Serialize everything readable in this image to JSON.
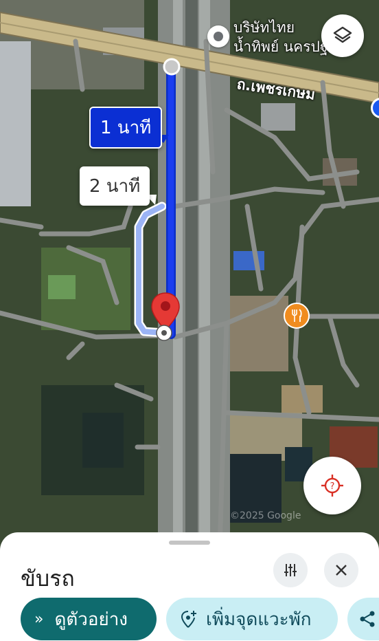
{
  "map": {
    "poi_label_line1": "บริษัทไทย",
    "poi_label_line2": "น้ำทิพย์ นครปฐม",
    "road_label": "ถ.เพชรเกษม",
    "route_selected_time": "1 นาที",
    "route_alt_time": "2 นาที",
    "watermark": "©2025 Google",
    "icons": {
      "layers": "layers-icon",
      "locate": "my-location-icon",
      "restaurant": "restaurant-icon",
      "destination": "red-pin-icon",
      "poi": "poi-marker-icon"
    },
    "colors": {
      "route_selected": "#1a3df0",
      "route_alt": "#9bb4f5",
      "pin": "#e53935",
      "restaurant": "#f08c1f"
    }
  },
  "sheet": {
    "title": "ขับรถ",
    "preview_label": "ดูตัวอย่าง",
    "add_stop_label": "เพิ่มจุดแวะพัก",
    "icons": {
      "filter": "tune-icon",
      "close": "close-icon",
      "preview": "double-chevron-icon",
      "add_stop": "add-location-icon",
      "share": "share-icon"
    },
    "colors": {
      "primary": "#0f6b6e",
      "secondary_bg": "#c9eef4"
    }
  }
}
